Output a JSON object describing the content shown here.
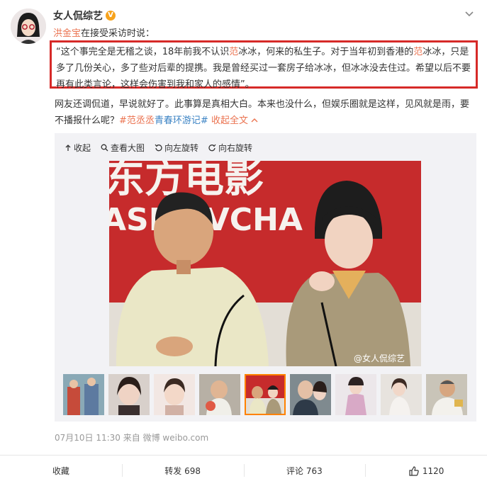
{
  "post": {
    "author": "女人侃综艺",
    "verified_badge": "V",
    "more_icon": "chevron-down-icon",
    "mention_name": "洪金宝",
    "mention_suffix": "在接受采访时说：",
    "quote": {
      "p1": "“这个事完全是无稽之谈，18年前我不认识",
      "h1": "范",
      "p2": "冰冰，何来的私生子。对于当年初到香港的",
      "h2": "范",
      "p3": "冰冰，只是多了几份关心，多了些对后辈的提携。我是曾经买过一套房子给冰冰，但冰冰没去住过。希望以后不要再有此类言论，这样会伤害到我和家人的感情”。"
    },
    "body": {
      "text": "网友还调侃道，早说就好了。此事算是真相大白。本来也没什么，但娱乐圈就是这样，见风就是雨，要不播报什么呢？",
      "tag1": "#范丞丞",
      "tag2": "青春环游记#",
      "fold": "收起全文"
    },
    "toolbar": {
      "collapse": "收起",
      "view_large": "查看大图",
      "rotate_left": "向左旋转",
      "rotate_right": "向右旋转"
    },
    "image": {
      "banner_top": "东方电影",
      "banner_bottom": "ASMOVCHA",
      "watermark": "@女人侃综艺"
    },
    "thumbnails_count": 9,
    "active_thumbnail": 5,
    "timestamp": "07月10日 11:30",
    "source_prefix": "来自",
    "source": "微博 weibo.com",
    "footer": {
      "favorite": "收藏",
      "repost": "转发 698",
      "comment": "评论 763",
      "like": "1120"
    },
    "colors": {
      "highlight": "#eb7350",
      "link_blue": "#3b83c4",
      "box_red": "#d62a28",
      "active_thumb": "#ff8200"
    }
  }
}
